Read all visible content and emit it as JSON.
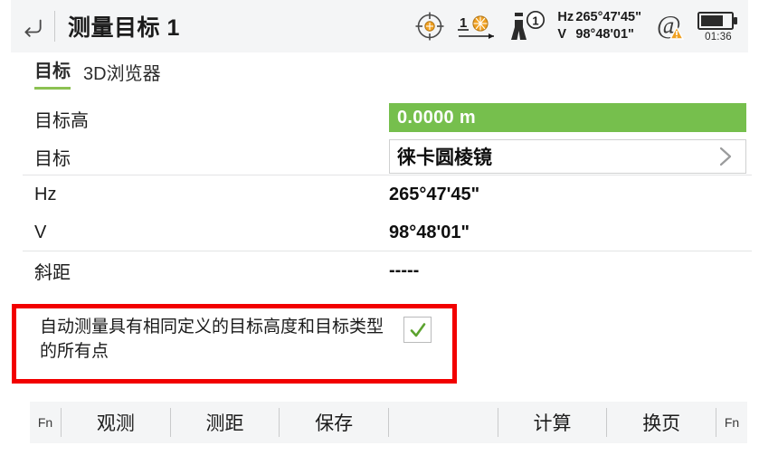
{
  "header": {
    "back_icon": "back-arrow-icon",
    "title": "测量目标 1",
    "status": {
      "target_lock_icon": "crosshair-target-icon",
      "prism_number": "1",
      "prism_icon": "prism-icon",
      "instrument_icon": "total-station-icon",
      "instrument_face": "1",
      "hz_label": "Hz",
      "hz_value": "265°47'45\"",
      "v_label": "V",
      "v_value": "98°48'01\"",
      "at_icon": "at-warning-icon",
      "battery_icon": "battery-icon",
      "battery_time": "01:36"
    }
  },
  "tabs": [
    {
      "label": "目标",
      "active": true
    },
    {
      "label": "3D浏览器",
      "active": false
    }
  ],
  "form": {
    "rows": [
      {
        "label": "目标高",
        "value": "0.0000 m",
        "type": "green-field"
      },
      {
        "label": "目标",
        "value": "徕卡圆棱镜",
        "type": "select"
      },
      {
        "label": "Hz",
        "value": "265°47'45\"",
        "type": "text"
      },
      {
        "label": "V",
        "value": "98°48'01\"",
        "type": "text"
      },
      {
        "label": "斜距",
        "value": "-----",
        "type": "text"
      }
    ]
  },
  "option": {
    "text": "自动测量具有相同定义的目标高度和目标类型的所有点",
    "checked": true,
    "check_glyph": "✓",
    "highlight_color": "#f20000"
  },
  "toolbar": {
    "fn_left": "Fn",
    "fn_right": "Fn",
    "buttons": [
      "观测",
      "测距",
      "保存",
      "",
      "计算",
      "换页"
    ]
  },
  "colors": {
    "accent_green": "#76bf4d",
    "tab_underline": "#8cc152",
    "warning_orange": "#f0a020",
    "highlight_red": "#f20000",
    "header_bg": "#f4f5f6"
  }
}
